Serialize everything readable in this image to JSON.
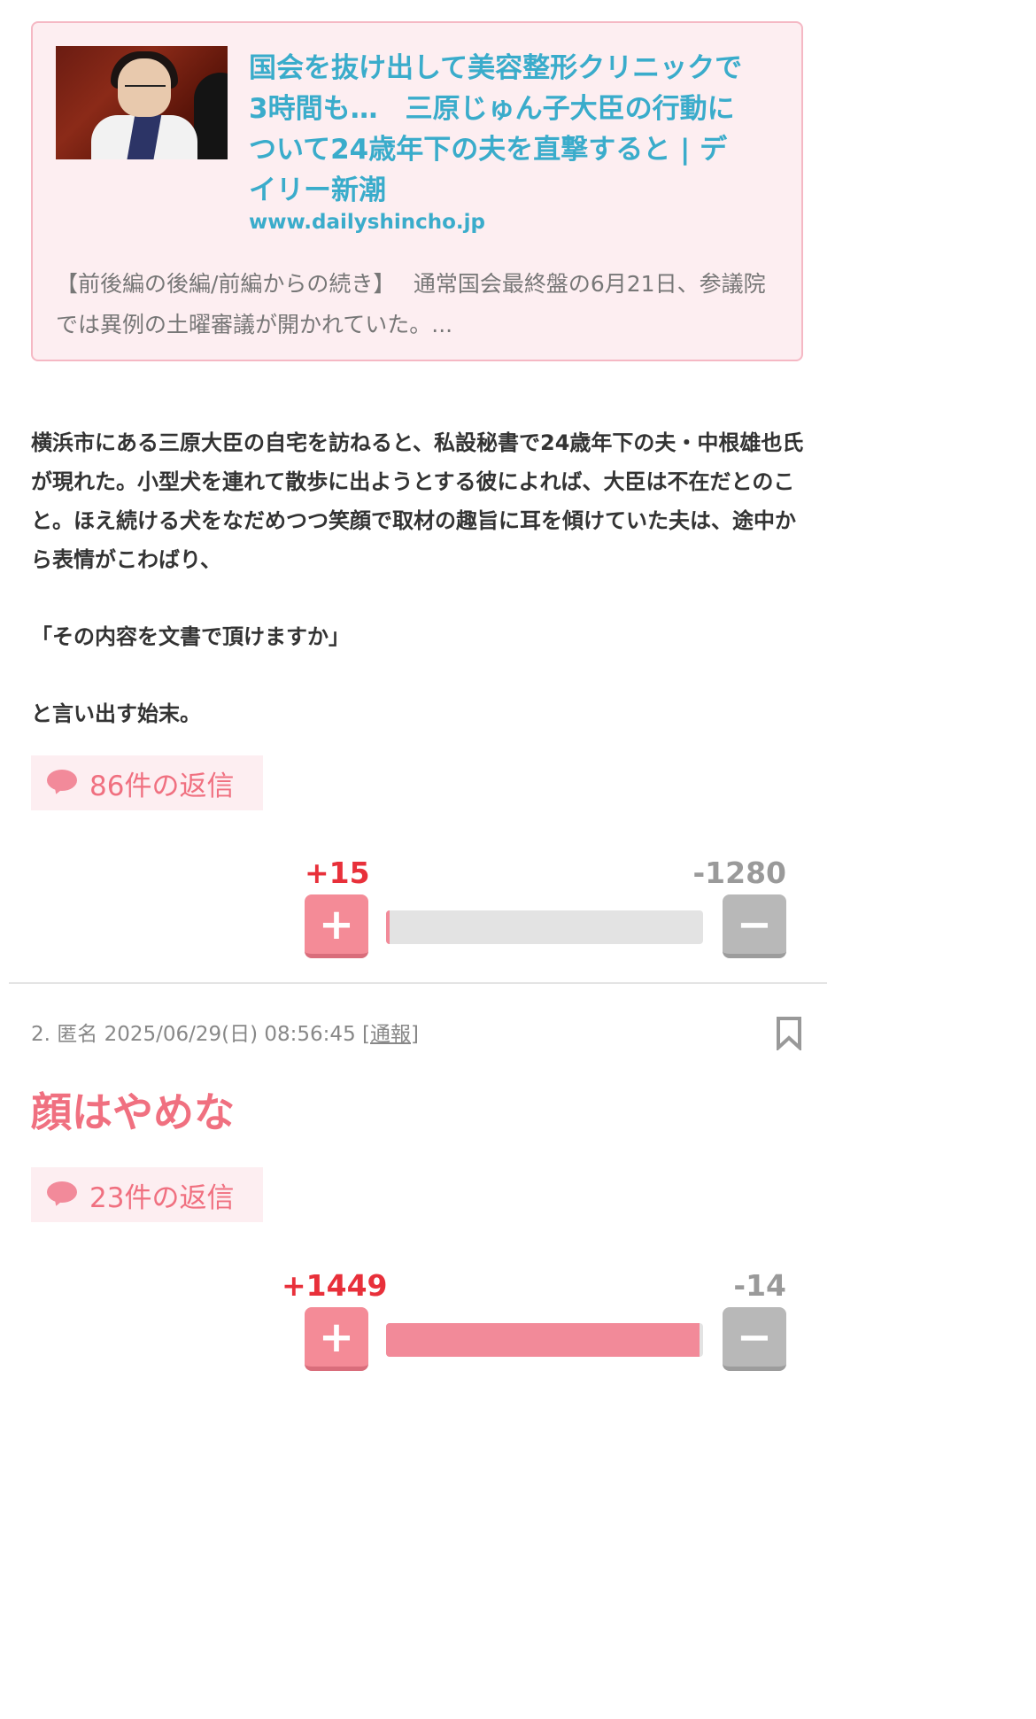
{
  "link_card": {
    "title": "国会を抜け出して美容整形クリニックで3時間も…　三原じゅん子大臣の行動について24歳年下の夫を直撃すると | デイリー新潮",
    "domain": "www.dailyshincho.jp",
    "description": "【前後編の後編/前編からの続き】　 通常国会最終盤の6月21日、参議院では異例の土曜審議が開かれていた。..."
  },
  "post1": {
    "paragraph1": "横浜市にある三原大臣の自宅を訪ねると、私設秘書で24歳年下の夫・中根雄也氏が現れた。小型犬を連れて散歩に出ようとする彼によれば、大臣は不在だとのこと。ほえ続ける犬をなだめつつ笑顔で取材の趣旨に耳を傾けていた夫は、途中から表情がこわばり、",
    "paragraph2": "「その内容を文書で頂けますか」",
    "paragraph3": "と言い出す始末。",
    "reply_label": "86件の返信",
    "vote": {
      "plus": "+15",
      "minus": "-1280",
      "plus_ratio": 0.012
    }
  },
  "post2": {
    "number": "2.",
    "author": "匿名",
    "datetime": "2025/06/29(日) 08:56:45",
    "report_label": "通報",
    "headline": "顔はやめな",
    "reply_label": "23件の返信",
    "vote": {
      "plus": "+1449",
      "minus": "-14",
      "plus_ratio": 0.99
    }
  },
  "icons": {
    "reply": "speech-bubble-icon",
    "bookmark": "bookmark-icon",
    "plus": "plus-icon",
    "minus": "minus-icon"
  },
  "colors": {
    "link": "#3aaccb",
    "accent_pink": "#f07080",
    "plus_red": "#e8303a",
    "card_bg": "#fdeef1"
  }
}
